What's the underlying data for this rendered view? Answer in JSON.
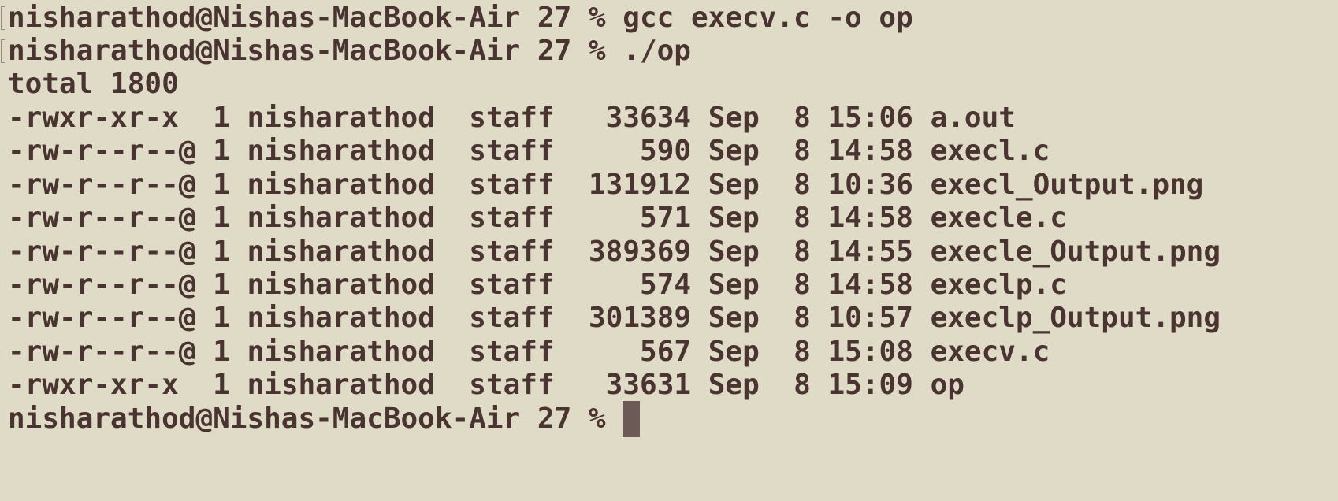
{
  "terminal": {
    "prompt": "nisharathod@Nishas-MacBook-Air 27 %",
    "commands": [
      "gcc execv.c -o op",
      "./op"
    ],
    "total_line": "total 1800",
    "listing": [
      {
        "perms": "-rwxr-xr-x ",
        "links": "1",
        "owner": "nisharathod",
        "group": "staff",
        "size": "33634",
        "month": "Sep",
        "day": "8",
        "time": "15:06",
        "name": "a.out"
      },
      {
        "perms": "-rw-r--r--@",
        "links": "1",
        "owner": "nisharathod",
        "group": "staff",
        "size": "590",
        "month": "Sep",
        "day": "8",
        "time": "14:58",
        "name": "execl.c"
      },
      {
        "perms": "-rw-r--r--@",
        "links": "1",
        "owner": "nisharathod",
        "group": "staff",
        "size": "131912",
        "month": "Sep",
        "day": "8",
        "time": "10:36",
        "name": "execl_Output.png"
      },
      {
        "perms": "-rw-r--r--@",
        "links": "1",
        "owner": "nisharathod",
        "group": "staff",
        "size": "571",
        "month": "Sep",
        "day": "8",
        "time": "14:58",
        "name": "execle.c"
      },
      {
        "perms": "-rw-r--r--@",
        "links": "1",
        "owner": "nisharathod",
        "group": "staff",
        "size": "389369",
        "month": "Sep",
        "day": "8",
        "time": "14:55",
        "name": "execle_Output.png"
      },
      {
        "perms": "-rw-r--r--@",
        "links": "1",
        "owner": "nisharathod",
        "group": "staff",
        "size": "574",
        "month": "Sep",
        "day": "8",
        "time": "14:58",
        "name": "execlp.c"
      },
      {
        "perms": "-rw-r--r--@",
        "links": "1",
        "owner": "nisharathod",
        "group": "staff",
        "size": "301389",
        "month": "Sep",
        "day": "8",
        "time": "10:57",
        "name": "execlp_Output.png"
      },
      {
        "perms": "-rw-r--r--@",
        "links": "1",
        "owner": "nisharathod",
        "group": "staff",
        "size": "567",
        "month": "Sep",
        "day": "8",
        "time": "15:08",
        "name": "execv.c"
      },
      {
        "perms": "-rwxr-xr-x ",
        "links": "1",
        "owner": "nisharathod",
        "group": "staff",
        "size": "33631",
        "month": "Sep",
        "day": "8",
        "time": "15:09",
        "name": "op"
      }
    ],
    "colors": {
      "background": "#e0dbc6",
      "text": "#4a3431",
      "cursor": "#6b5a57"
    }
  }
}
